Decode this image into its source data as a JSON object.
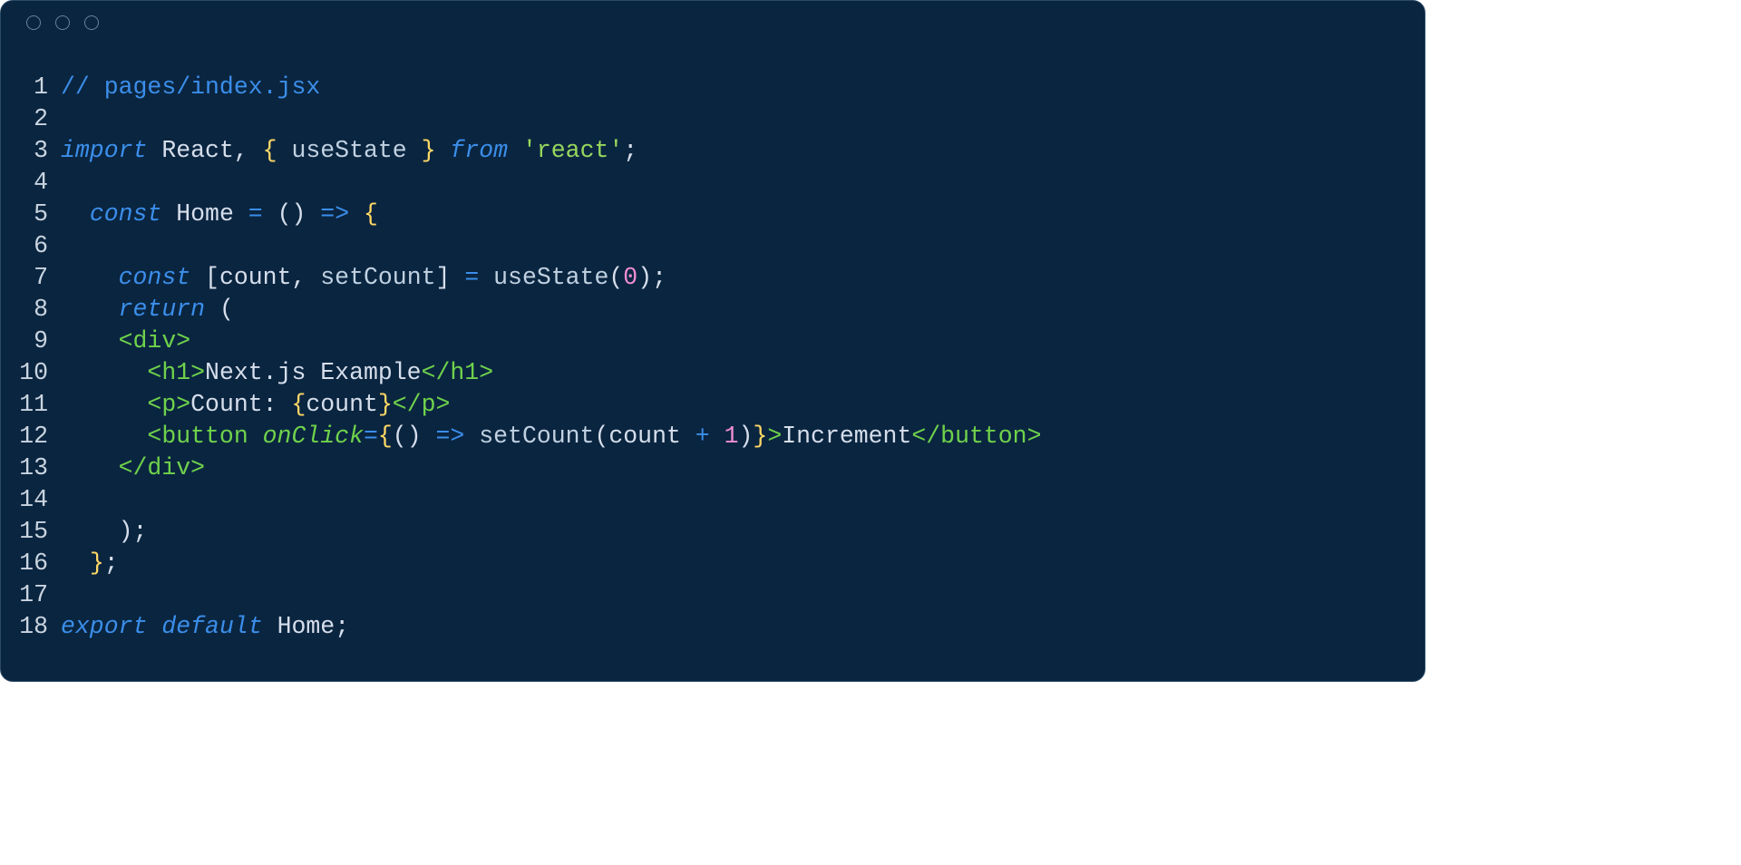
{
  "editor": {
    "filename": "pages/index.jsx",
    "language": "jsx",
    "lines": [
      {
        "n": "1",
        "ind": "",
        "tokens": [
          {
            "c": "c-comment",
            "t": "// pages/index.jsx"
          }
        ]
      },
      {
        "n": "2",
        "ind": "",
        "tokens": []
      },
      {
        "n": "3",
        "ind": "",
        "tokens": [
          {
            "c": "c-keyword",
            "t": "import"
          },
          {
            "c": "c-default",
            "t": " "
          },
          {
            "c": "c-ident",
            "t": "React"
          },
          {
            "c": "c-default",
            "t": ", "
          },
          {
            "c": "c-brace",
            "t": "{"
          },
          {
            "c": "c-default",
            "t": " "
          },
          {
            "c": "c-func",
            "t": "useState"
          },
          {
            "c": "c-default",
            "t": " "
          },
          {
            "c": "c-brace",
            "t": "}"
          },
          {
            "c": "c-default",
            "t": " "
          },
          {
            "c": "c-keyword",
            "t": "from"
          },
          {
            "c": "c-default",
            "t": " "
          },
          {
            "c": "c-string",
            "t": "'react'"
          },
          {
            "c": "c-default",
            "t": ";"
          }
        ]
      },
      {
        "n": "4",
        "ind": "",
        "tokens": []
      },
      {
        "n": "5",
        "ind": "  ",
        "tokens": [
          {
            "c": "c-keyword",
            "t": "const"
          },
          {
            "c": "c-default",
            "t": " "
          },
          {
            "c": "c-ident",
            "t": "Home"
          },
          {
            "c": "c-default",
            "t": " "
          },
          {
            "c": "c-keyword",
            "t": "="
          },
          {
            "c": "c-default",
            "t": " "
          },
          {
            "c": "c-paren",
            "t": "("
          },
          {
            "c": "c-paren",
            "t": ")"
          },
          {
            "c": "c-default",
            "t": " "
          },
          {
            "c": "c-arrow",
            "t": "=>"
          },
          {
            "c": "c-default",
            "t": " "
          },
          {
            "c": "c-brace",
            "t": "{"
          }
        ]
      },
      {
        "n": "6",
        "ind": "",
        "tokens": []
      },
      {
        "n": "7",
        "ind": "    ",
        "tokens": [
          {
            "c": "c-keyword",
            "t": "const"
          },
          {
            "c": "c-default",
            "t": " "
          },
          {
            "c": "c-paren",
            "t": "["
          },
          {
            "c": "c-ident",
            "t": "count"
          },
          {
            "c": "c-default",
            "t": ", "
          },
          {
            "c": "c-func",
            "t": "setCount"
          },
          {
            "c": "c-paren",
            "t": "]"
          },
          {
            "c": "c-default",
            "t": " "
          },
          {
            "c": "c-keyword",
            "t": "="
          },
          {
            "c": "c-default",
            "t": " "
          },
          {
            "c": "c-func",
            "t": "useState"
          },
          {
            "c": "c-paren",
            "t": "("
          },
          {
            "c": "c-number",
            "t": "0"
          },
          {
            "c": "c-paren",
            "t": ")"
          },
          {
            "c": "c-default",
            "t": ";"
          }
        ]
      },
      {
        "n": "8",
        "ind": "    ",
        "tokens": [
          {
            "c": "c-keyword",
            "t": "return"
          },
          {
            "c": "c-default",
            "t": " "
          },
          {
            "c": "c-paren",
            "t": "("
          }
        ]
      },
      {
        "n": "9",
        "ind": "    ",
        "tokens": [
          {
            "c": "c-tag",
            "t": "<div>"
          }
        ]
      },
      {
        "n": "10",
        "ind": "      ",
        "tokens": [
          {
            "c": "c-tag",
            "t": "<h1>"
          },
          {
            "c": "c-jsxtext",
            "t": "Next.js Example"
          },
          {
            "c": "c-tag",
            "t": "</h1>"
          }
        ]
      },
      {
        "n": "11",
        "ind": "      ",
        "tokens": [
          {
            "c": "c-tag",
            "t": "<p>"
          },
          {
            "c": "c-jsxtext",
            "t": "Count: "
          },
          {
            "c": "c-brace",
            "t": "{"
          },
          {
            "c": "c-ident",
            "t": "count"
          },
          {
            "c": "c-brace",
            "t": "}"
          },
          {
            "c": "c-tag",
            "t": "</p>"
          }
        ]
      },
      {
        "n": "12",
        "ind": "      ",
        "tokens": [
          {
            "c": "c-tag",
            "t": "<button"
          },
          {
            "c": "c-default",
            "t": " "
          },
          {
            "c": "c-attr",
            "t": "onClick"
          },
          {
            "c": "c-keyword",
            "t": "="
          },
          {
            "c": "c-brace",
            "t": "{"
          },
          {
            "c": "c-paren",
            "t": "("
          },
          {
            "c": "c-paren",
            "t": ")"
          },
          {
            "c": "c-default",
            "t": " "
          },
          {
            "c": "c-arrow",
            "t": "=>"
          },
          {
            "c": "c-default",
            "t": " "
          },
          {
            "c": "c-func",
            "t": "setCount"
          },
          {
            "c": "c-paren",
            "t": "("
          },
          {
            "c": "c-ident",
            "t": "count"
          },
          {
            "c": "c-default",
            "t": " "
          },
          {
            "c": "c-keyword",
            "t": "+"
          },
          {
            "c": "c-default",
            "t": " "
          },
          {
            "c": "c-number",
            "t": "1"
          },
          {
            "c": "c-paren",
            "t": ")"
          },
          {
            "c": "c-brace",
            "t": "}"
          },
          {
            "c": "c-tag",
            "t": ">"
          },
          {
            "c": "c-jsxtext",
            "t": "Increment"
          },
          {
            "c": "c-tag",
            "t": "</button>"
          }
        ]
      },
      {
        "n": "13",
        "ind": "    ",
        "tokens": [
          {
            "c": "c-tag",
            "t": "</div>"
          }
        ]
      },
      {
        "n": "14",
        "ind": "",
        "tokens": []
      },
      {
        "n": "15",
        "ind": "    ",
        "tokens": [
          {
            "c": "c-paren",
            "t": ")"
          },
          {
            "c": "c-default",
            "t": ";"
          }
        ]
      },
      {
        "n": "16",
        "ind": "  ",
        "tokens": [
          {
            "c": "c-brace",
            "t": "}"
          },
          {
            "c": "c-default",
            "t": ";"
          }
        ]
      },
      {
        "n": "17",
        "ind": "",
        "tokens": []
      },
      {
        "n": "18",
        "ind": "",
        "tokens": [
          {
            "c": "c-keyword",
            "t": "export"
          },
          {
            "c": "c-default",
            "t": " "
          },
          {
            "c": "c-keyword",
            "t": "default"
          },
          {
            "c": "c-default",
            "t": " "
          },
          {
            "c": "c-ident",
            "t": "Home"
          },
          {
            "c": "c-default",
            "t": ";"
          }
        ]
      }
    ]
  }
}
